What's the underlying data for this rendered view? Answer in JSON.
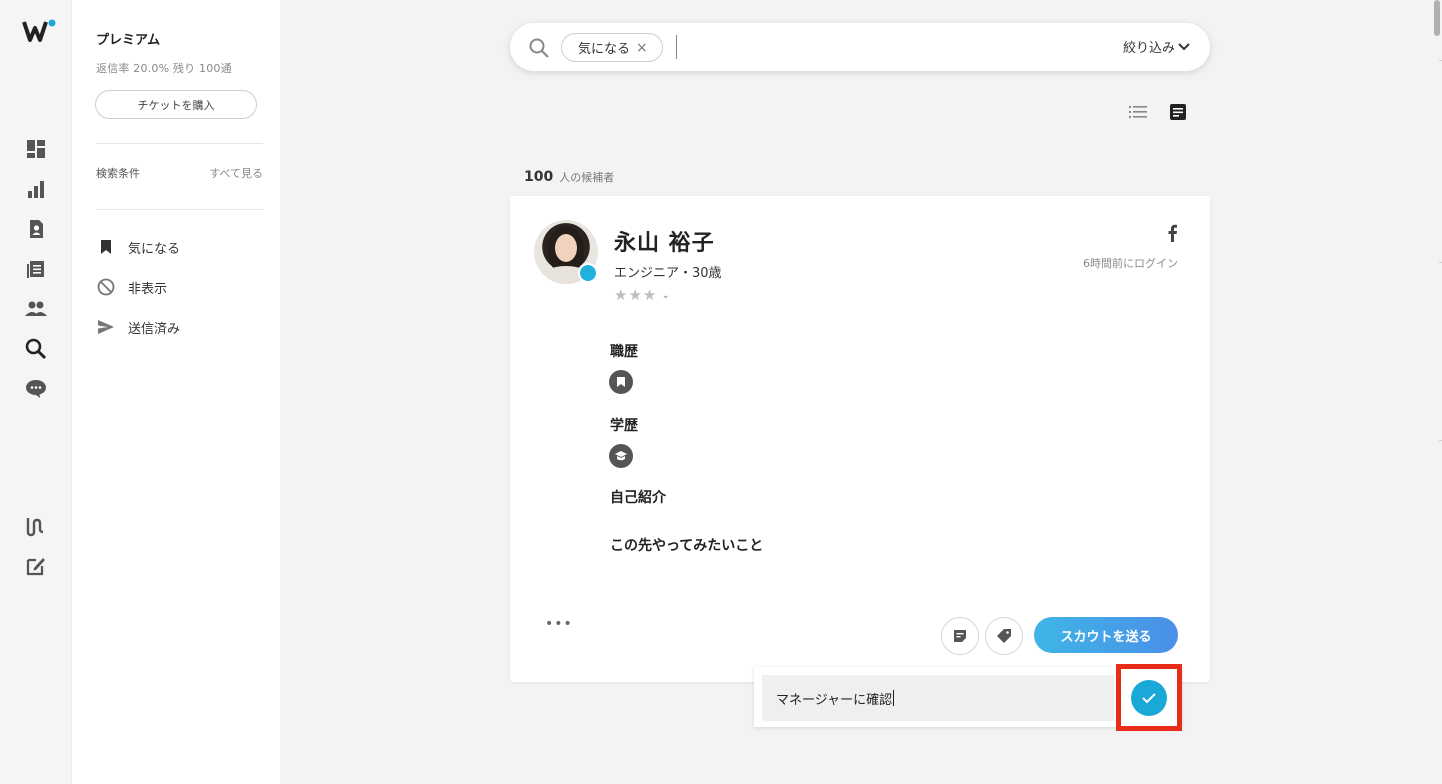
{
  "rail": {
    "icons": [
      "dashboard-icon",
      "analytics-icon",
      "profile-doc-icon",
      "articles-icon",
      "people-icon",
      "search-icon",
      "chat-icon",
      "wantedly-icon",
      "compose-icon"
    ]
  },
  "panel": {
    "plan": "プレミアム",
    "plan_info": "返信率 20.0%  残り 100通",
    "ticket_button": "チケットを購入",
    "conditions_label": "検索条件",
    "see_all": "すべて見る",
    "nav": [
      {
        "label": "気になる",
        "icon": "bookmark-icon"
      },
      {
        "label": "非表示",
        "icon": "hidden-icon"
      },
      {
        "label": "送信済み",
        "icon": "send-icon"
      }
    ]
  },
  "search": {
    "chip_label": "気になる",
    "chip_remove": "×",
    "filter_label": "絞り込み"
  },
  "results": {
    "count": "100",
    "count_suffix": "人の候補者"
  },
  "candidate": {
    "name": "永山 裕子",
    "subtitle": "エンジニア・30歳",
    "rating": "★★★",
    "last_login": "6時間前にログイン",
    "sections": {
      "career": "職歴",
      "education": "学歴",
      "intro": "自己紹介",
      "future": "この先やってみたいこと"
    },
    "more": "•••",
    "scout_button": "スカウトを送る"
  },
  "memo": {
    "value": "マネージャーに確認"
  },
  "colors": {
    "accent": "#1aa8d9",
    "highlight": "#e82c1a"
  }
}
